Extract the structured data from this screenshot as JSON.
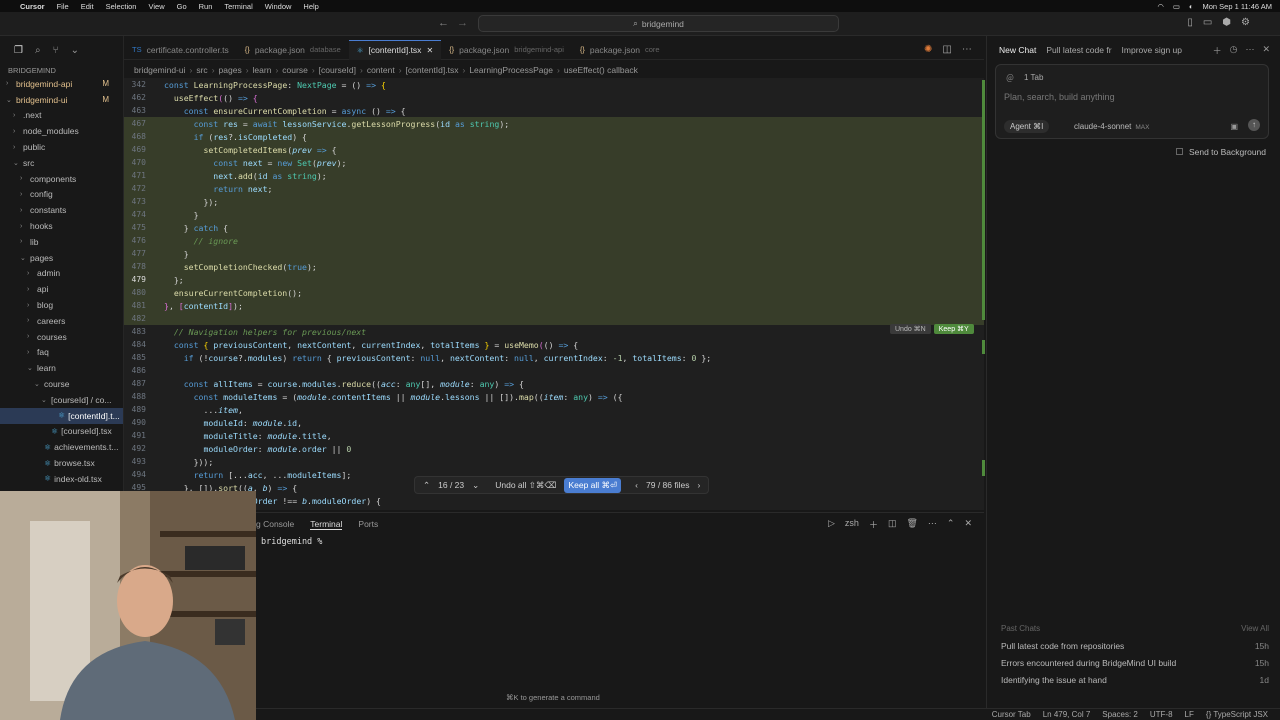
{
  "menubar": {
    "app": "Cursor",
    "items": [
      "File",
      "Edit",
      "Selection",
      "View",
      "Go",
      "Run",
      "Terminal",
      "Window",
      "Help"
    ],
    "clock": "Mon Sep 1  11:46 AM"
  },
  "search": {
    "label": "bridgemind"
  },
  "explorer": {
    "root": "BRIDGEMIND",
    "rows": [
      {
        "label": "bridgemind-api",
        "depth": 0,
        "chev": "›",
        "badge": "M",
        "file": false
      },
      {
        "label": "bridgemind-ui",
        "depth": 0,
        "chev": "⌄",
        "badge": "M",
        "file": false
      },
      {
        "label": ".next",
        "depth": 1,
        "chev": "›",
        "badge": "",
        "file": false
      },
      {
        "label": "node_modules",
        "depth": 1,
        "chev": "›",
        "badge": "",
        "file": false
      },
      {
        "label": "public",
        "depth": 1,
        "chev": "›",
        "badge": "",
        "file": false
      },
      {
        "label": "src",
        "depth": 1,
        "chev": "⌄",
        "badge": "",
        "file": false
      },
      {
        "label": "components",
        "depth": 2,
        "chev": "›",
        "badge": "",
        "file": false
      },
      {
        "label": "config",
        "depth": 2,
        "chev": "›",
        "badge": "",
        "file": false
      },
      {
        "label": "constants",
        "depth": 2,
        "chev": "›",
        "badge": "",
        "file": false
      },
      {
        "label": "hooks",
        "depth": 2,
        "chev": "›",
        "badge": "",
        "file": false
      },
      {
        "label": "lib",
        "depth": 2,
        "chev": "›",
        "badge": "",
        "file": false
      },
      {
        "label": "pages",
        "depth": 2,
        "chev": "⌄",
        "badge": "",
        "file": false
      },
      {
        "label": "admin",
        "depth": 3,
        "chev": "›",
        "badge": "",
        "file": false
      },
      {
        "label": "api",
        "depth": 3,
        "chev": "›",
        "badge": "",
        "file": false
      },
      {
        "label": "blog",
        "depth": 3,
        "chev": "›",
        "badge": "",
        "file": false
      },
      {
        "label": "careers",
        "depth": 3,
        "chev": "›",
        "badge": "",
        "file": false
      },
      {
        "label": "courses",
        "depth": 3,
        "chev": "›",
        "badge": "",
        "file": false
      },
      {
        "label": "faq",
        "depth": 3,
        "chev": "›",
        "badge": "",
        "file": false
      },
      {
        "label": "learn",
        "depth": 3,
        "chev": "⌄",
        "badge": "",
        "file": false
      },
      {
        "label": "course",
        "depth": 4,
        "chev": "⌄",
        "badge": "",
        "file": false
      },
      {
        "label": "[courseId] / co...",
        "depth": 5,
        "chev": "⌄",
        "badge": "",
        "file": false
      },
      {
        "label": "[contentId].t...",
        "depth": 6,
        "chev": "",
        "badge": "",
        "file": true,
        "selected": true
      },
      {
        "label": "[courseId].tsx",
        "depth": 5,
        "chev": "",
        "badge": "",
        "file": true
      },
      {
        "label": "achievements.t...",
        "depth": 4,
        "chev": "",
        "badge": "",
        "file": true
      },
      {
        "label": "browse.tsx",
        "depth": 4,
        "chev": "",
        "badge": "",
        "file": true
      },
      {
        "label": "index-old.tsx",
        "depth": 4,
        "chev": "",
        "badge": "",
        "file": true
      }
    ]
  },
  "tabs": [
    {
      "icon": "TS",
      "label": "certificate.controller.ts",
      "dim": "",
      "active": false
    },
    {
      "icon": "{}",
      "label": "package.json",
      "dim": "database",
      "active": false
    },
    {
      "icon": "⚛",
      "label": "[contentId].tsx",
      "dim": "",
      "active": true
    },
    {
      "icon": "{}",
      "label": "package.json",
      "dim": "bridgemind-api",
      "active": false
    },
    {
      "icon": "{}",
      "label": "package.json",
      "dim": "core",
      "active": false
    }
  ],
  "breadcrumb": [
    "bridgemind-ui",
    "src",
    "pages",
    "learn",
    "course",
    "[courseId]",
    "content",
    "[contentId].tsx",
    "LearningProcessPage",
    "useEffect() callback"
  ],
  "editor": {
    "undo_label": "Undo ⌘N",
    "keep_label": "Keep ⌘Y",
    "review": {
      "counter": "16 / 23",
      "undo_all": "Undo all ⇧⌘⌫",
      "keep_all": "Keep all ⌘⏎",
      "files": "79 / 86 files"
    }
  },
  "terminal": {
    "tabs": [
      "g Console",
      "Terminal",
      "Ports"
    ],
    "shell": "zsh",
    "prompt": "bridgemind %",
    "hint": "⌘K to generate a command"
  },
  "statusbar": {
    "items": [
      "Cursor Tab",
      "Ln 479, Col 7",
      "Spaces: 2",
      "UTF-8",
      "LF",
      "{} TypeScript JSX"
    ]
  },
  "chat": {
    "tabs": [
      "New Chat",
      "Pull latest code fr",
      "Improve sign up"
    ],
    "tab_count": "1 Tab",
    "placeholder": "Plan, search, build anything",
    "agent": "Agent ⌘I",
    "model": "claude-4-sonnet",
    "max": "MAX",
    "send_bg": "Send to Background",
    "past_header": "Past Chats",
    "view_all": "View All",
    "past": [
      {
        "title": "Pull latest code from repositories",
        "time": "15h"
      },
      {
        "title": "Errors encountered during BridgeMind UI build",
        "time": "15h"
      },
      {
        "title": "Identifying the issue at hand",
        "time": "1d"
      }
    ]
  }
}
